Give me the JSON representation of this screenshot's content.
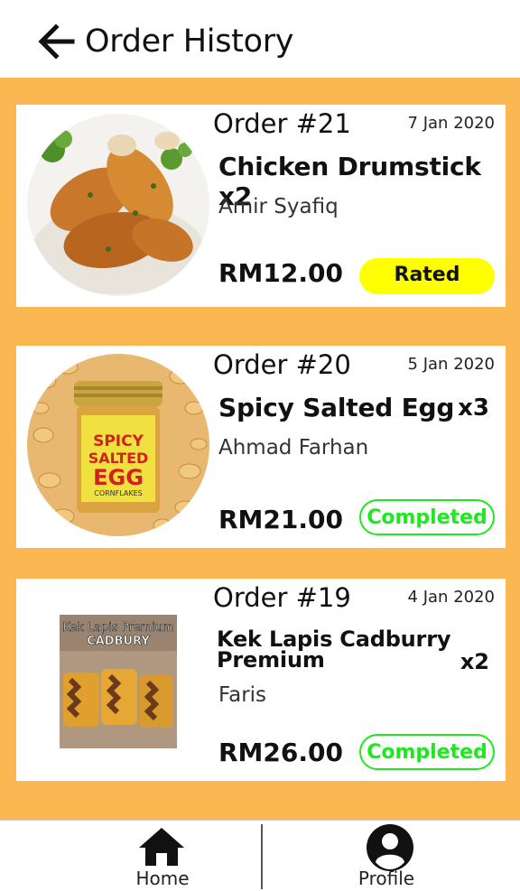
{
  "header": {
    "title": "Order History",
    "back_icon": "arrow-left-icon"
  },
  "colors": {
    "background": "#fbb752",
    "rated_badge": "#ffff00",
    "completed_badge": "#1ee81e"
  },
  "orders": [
    {
      "order_no": "Order #21",
      "date": "7  Jan 2020",
      "item": "Chicken Drumstick x2",
      "qty": "",
      "customer": "Amir Syafiq",
      "price": "RM12.00",
      "status": "Rated"
    },
    {
      "order_no": "Order #20",
      "date": "5  Jan 2020",
      "item": "Spicy Salted Egg",
      "qty": "x3",
      "customer": "Ahmad Farhan",
      "price": "RM21.00",
      "status": "Completed",
      "image_text": [
        "SPICY",
        "SALTED",
        "EGG",
        "CORNFLAKES"
      ]
    },
    {
      "order_no": "Order #19",
      "date": "4  Jan 2020",
      "item": "Kek Lapis Cadburry Premium",
      "item_line1": "Kek Lapis Cadburry",
      "item_line2": "Premium",
      "qty": "x2",
      "customer": "Faris",
      "price": "RM26.00",
      "status": "Completed",
      "image_text": [
        "Kek Lapis Premium",
        "CADBURY"
      ]
    }
  ],
  "navbar": {
    "home_label": "Home",
    "profile_label": "Profile",
    "home_icon": "home-icon",
    "profile_icon": "user-circle-icon"
  }
}
